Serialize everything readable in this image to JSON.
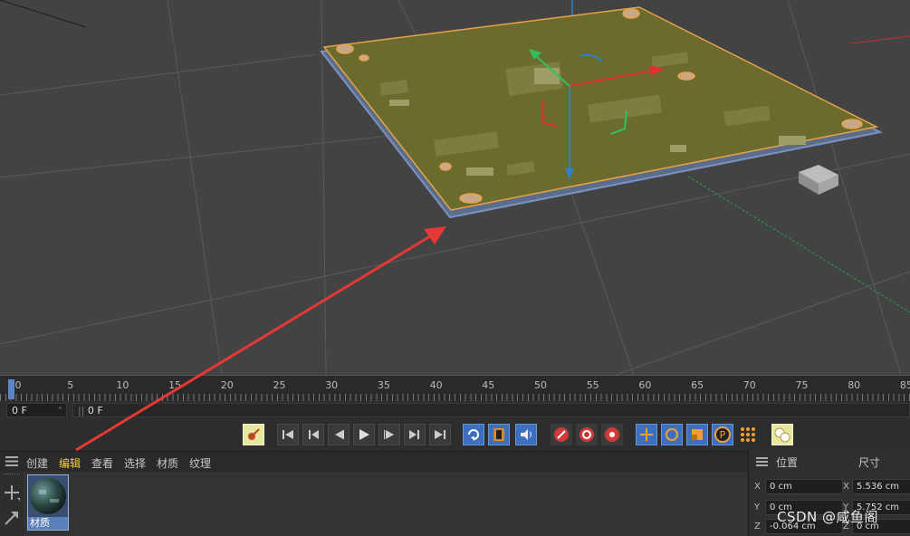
{
  "timeline": {
    "ticks": [
      "0",
      "5",
      "10",
      "15",
      "20",
      "25",
      "30",
      "35",
      "40",
      "45",
      "50",
      "55",
      "60",
      "65",
      "70",
      "75",
      "80",
      "85"
    ],
    "current_frame": "0 F",
    "range_field": "0 F"
  },
  "menu": {
    "items": [
      "创建",
      "编辑",
      "查看",
      "选择",
      "材质",
      "纹理"
    ],
    "active_index": 1
  },
  "material": {
    "name": "材质"
  },
  "coords": {
    "header_position": "位置",
    "header_size": "尺寸",
    "rows": [
      {
        "axis": "X",
        "pos": "0 cm",
        "size_axis": "X",
        "size": "5.536 cm"
      },
      {
        "axis": "Y",
        "pos": "0 cm",
        "size_axis": "Y",
        "size": "5.752 cm"
      },
      {
        "axis": "Z",
        "pos": "-0.064 cm",
        "size_axis": "Z",
        "size": "0 cm"
      }
    ]
  },
  "watermark": "CSDN @咸鱼阁",
  "colors": {
    "accent": "#f2d33b",
    "selection_blue": "#5b86c9",
    "annotation_arrow": "#e53935",
    "pcb_green": "#6b6a2c"
  }
}
